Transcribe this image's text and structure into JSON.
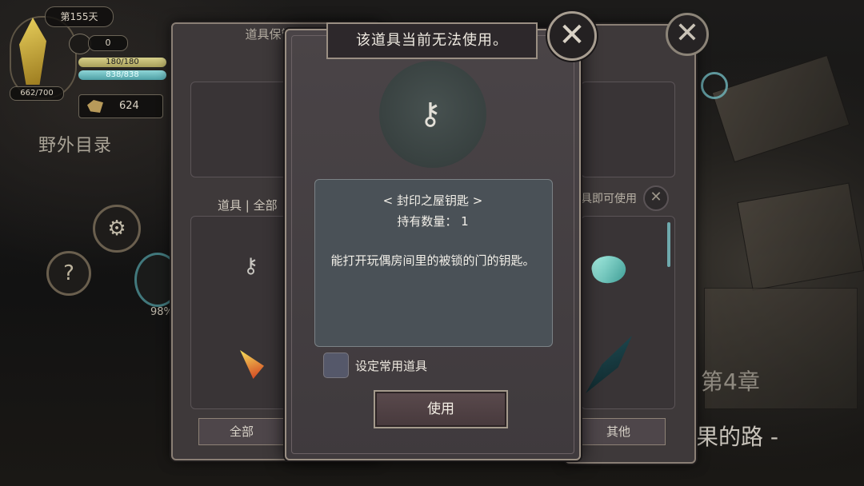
{
  "hud": {
    "day": "第155天",
    "calendar_count": "0",
    "hp": "180/180",
    "mp": "838/838",
    "food": "662/700",
    "gold": "624",
    "field_catalog": "野外目录",
    "percent": "98%"
  },
  "background_panel_left": {
    "title": "道具保管箱",
    "category_tab": "道具 | 全部",
    "bottom_tab_all": "全部"
  },
  "background_panel_right": {
    "hint": "具即可使用",
    "bottom_tab_other": "其他"
  },
  "chapter": {
    "label": "第4章",
    "subtitle": "果的路 -"
  },
  "dialog": {
    "title": "该道具当前无法使用。",
    "item_name": "< 封印之屋钥匙 >",
    "item_count": "持有数量： 1",
    "item_description": "能打开玩偶房间里的被锁的门的钥匙。",
    "checkbox_label": "设定常用道具",
    "use_button": "使用",
    "checkbox_checked": false
  },
  "icons": {
    "close": "close-icon",
    "key": "key-icon",
    "gear": "gear-icon",
    "help": "help-icon"
  },
  "colors": {
    "hp_bar": "#d7d08a",
    "mp_bar": "#8fd6d7",
    "dialog_bg": "#4a4447",
    "desc_bg": "#4a5157"
  }
}
